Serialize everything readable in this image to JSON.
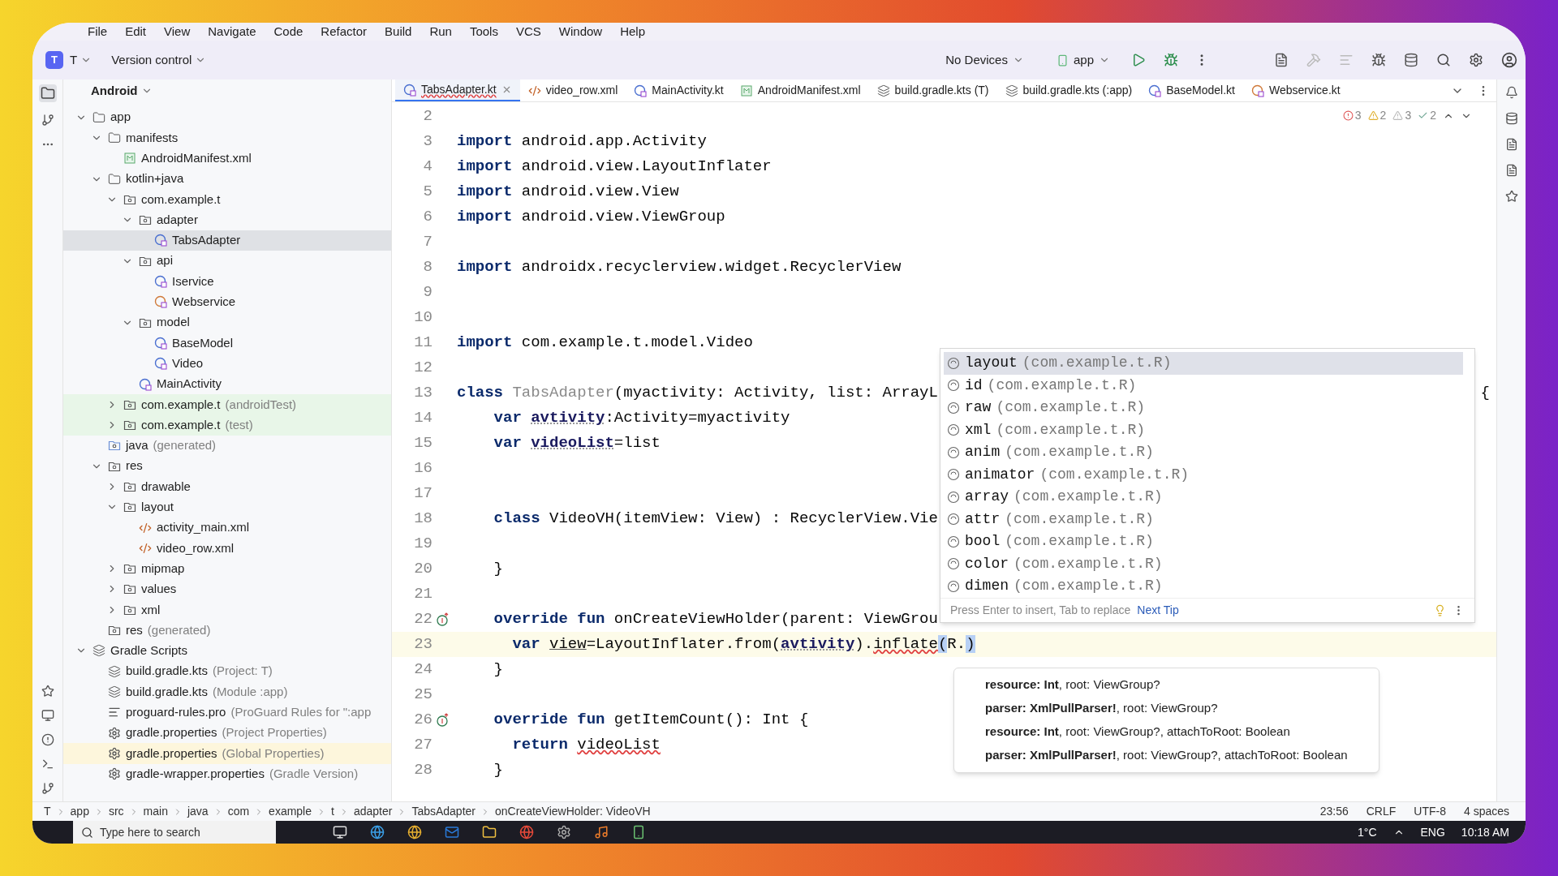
{
  "menu": [
    "File",
    "Edit",
    "View",
    "Navigate",
    "Code",
    "Refactor",
    "Build",
    "Run",
    "Tools",
    "VCS",
    "Window",
    "Help"
  ],
  "toolbar": {
    "project_badge": "T",
    "project": "T",
    "vcs": "Version control",
    "device": "No Devices",
    "config": "app"
  },
  "project_panel": {
    "view": "Android",
    "tree": [
      {
        "label": "app",
        "kind": "module",
        "expanded": true,
        "selected": false,
        "children": [
          {
            "label": "manifests",
            "kind": "folder",
            "expanded": true,
            "selected": false,
            "children": [
              {
                "label": "AndroidManifest.xml",
                "kind": "manifest",
                "selected": false
              }
            ]
          },
          {
            "label": "kotlin+java",
            "kind": "folder",
            "expanded": true,
            "selected": false,
            "children": [
              {
                "label": "com.example.t",
                "kind": "package",
                "expanded": true,
                "selected": false,
                "children": [
                  {
                    "label": "adapter",
                    "kind": "package",
                    "expanded": true,
                    "selected": false,
                    "children": [
                      {
                        "label": "TabsAdapter",
                        "kind": "class",
                        "selected": true
                      }
                    ]
                  },
                  {
                    "label": "api",
                    "kind": "package",
                    "expanded": true,
                    "selected": false,
                    "children": [
                      {
                        "label": "Iservice",
                        "kind": "interface",
                        "selected": false
                      },
                      {
                        "label": "Webservice",
                        "kind": "object",
                        "selected": false
                      }
                    ]
                  },
                  {
                    "label": "model",
                    "kind": "package",
                    "expanded": true,
                    "selected": false,
                    "children": [
                      {
                        "label": "BaseModel",
                        "kind": "class",
                        "selected": false
                      },
                      {
                        "label": "Video",
                        "kind": "class",
                        "selected": false
                      }
                    ]
                  },
                  {
                    "label": "MainActivity",
                    "kind": "class",
                    "selected": false
                  }
                ]
              },
              {
                "label": "com.example.t",
                "note": "(androidTest)",
                "color": "#e8f6e8",
                "kind": "package",
                "expanded": false,
                "selected": false
              },
              {
                "label": "com.example.t",
                "note": "(test)",
                "color": "#e8f6e8",
                "kind": "package",
                "expanded": false,
                "selected": false
              }
            ]
          },
          {
            "label": "java",
            "note": "(generated)",
            "kind": "generated",
            "selected": false
          },
          {
            "label": "res",
            "kind": "resources",
            "expanded": true,
            "selected": false,
            "children": [
              {
                "label": "drawable",
                "kind": "package",
                "expanded": false,
                "selected": false
              },
              {
                "label": "layout",
                "kind": "package",
                "expanded": true,
                "selected": false,
                "children": [
                  {
                    "label": "activity_main.xml",
                    "kind": "xml",
                    "selected": false
                  },
                  {
                    "label": "video_row.xml",
                    "kind": "xml",
                    "selected": false
                  }
                ]
              },
              {
                "label": "mipmap",
                "kind": "package",
                "expanded": false,
                "selected": false
              },
              {
                "label": "values",
                "kind": "package",
                "expanded": false,
                "selected": false
              },
              {
                "label": "xml",
                "kind": "package",
                "expanded": false,
                "selected": false
              }
            ]
          },
          {
            "label": "res",
            "note": "(generated)",
            "kind": "resources",
            "selected": false
          }
        ]
      },
      {
        "label": "Gradle Scripts",
        "kind": "gradle",
        "expanded": true,
        "selected": false,
        "children": [
          {
            "label": "build.gradle.kts",
            "note": "(Project: T)",
            "kind": "gradle",
            "selected": false
          },
          {
            "label": "build.gradle.kts",
            "note": "(Module :app)",
            "kind": "gradle",
            "selected": false
          },
          {
            "label": "proguard-rules.pro",
            "note": "(ProGuard Rules for \":app",
            "kind": "text",
            "selected": false
          },
          {
            "label": "gradle.properties",
            "note": "(Project Properties)",
            "kind": "settings",
            "selected": false
          },
          {
            "label": "gradle.properties",
            "note": "(Global Properties)",
            "color": "#fdf6dc",
            "kind": "settings",
            "selected": false
          },
          {
            "label": "gradle-wrapper.properties",
            "note": "(Gradle Version)",
            "kind": "settings",
            "selected": false
          }
        ]
      }
    ]
  },
  "tabs": [
    {
      "label": "TabsAdapter.kt",
      "kind": "class",
      "selected": true
    },
    {
      "label": "video_row.xml",
      "kind": "xml",
      "selected": false
    },
    {
      "label": "MainActivity.kt",
      "kind": "class",
      "selected": false
    },
    {
      "label": "AndroidManifest.xml",
      "kind": "manifest",
      "selected": false
    },
    {
      "label": "build.gradle.kts (T)",
      "kind": "gradle",
      "selected": false
    },
    {
      "label": "build.gradle.kts (:app)",
      "kind": "gradle",
      "selected": false
    },
    {
      "label": "BaseModel.kt",
      "kind": "class",
      "selected": false
    },
    {
      "label": "Webservice.kt",
      "kind": "object",
      "selected": false
    }
  ],
  "inspections": {
    "errors": "3",
    "warnings": "2",
    "weak_warnings": "3",
    "typos": "2"
  },
  "code": [
    {
      "number": "2",
      "current": false,
      "override_marker": false
    },
    {
      "number": "3",
      "current": false,
      "override_marker": false,
      "segments": [
        {
          "kind": "kw",
          "text": "import "
        },
        {
          "kind": "text",
          "text": "android.app.Activity"
        }
      ]
    },
    {
      "number": "4",
      "current": false,
      "override_marker": false,
      "segments": [
        {
          "kind": "kw",
          "text": "import "
        },
        {
          "kind": "text",
          "text": "android.view.LayoutInflater"
        }
      ]
    },
    {
      "number": "5",
      "current": false,
      "override_marker": false,
      "segments": [
        {
          "kind": "kw",
          "text": "import "
        },
        {
          "kind": "text",
          "text": "android.view.View"
        }
      ]
    },
    {
      "number": "6",
      "current": false,
      "override_marker": false,
      "segments": [
        {
          "kind": "kw",
          "text": "import "
        },
        {
          "kind": "text",
          "text": "android.view.ViewGroup"
        }
      ]
    },
    {
      "number": "7",
      "current": false,
      "override_marker": false
    },
    {
      "number": "8",
      "current": false,
      "override_marker": false,
      "segments": [
        {
          "kind": "kw",
          "text": "import "
        },
        {
          "kind": "text",
          "text": "androidx.recyclerview.widget.RecyclerView"
        }
      ]
    },
    {
      "number": "9",
      "current": false,
      "override_marker": false
    },
    {
      "number": "10",
      "current": false,
      "override_marker": false
    },
    {
      "number": "11",
      "current": false,
      "override_marker": false,
      "segments": [
        {
          "kind": "kw",
          "text": "import "
        },
        {
          "kind": "text",
          "text": "com.example.t.model.Video"
        }
      ]
    },
    {
      "number": "12",
      "current": false,
      "override_marker": false
    },
    {
      "number": "13",
      "current": false,
      "override_marker": false,
      "tail": "{",
      "segments": [
        {
          "kind": "kw",
          "text": "class "
        },
        {
          "kind": "dim",
          "text": "TabsAdapter"
        },
        {
          "kind": "text",
          "text": "(myactivity: Activity, list: ArrayL"
        }
      ]
    },
    {
      "number": "14",
      "current": false,
      "override_marker": false,
      "segments": [
        {
          "kind": "kw",
          "text": "    var "
        },
        {
          "kind": "prop",
          "text": "avtivity"
        },
        {
          "kind": "text",
          "text": ":Activity=myactivity"
        }
      ]
    },
    {
      "number": "15",
      "current": false,
      "override_marker": false,
      "segments": [
        {
          "kind": "kw",
          "text": "    var "
        },
        {
          "kind": "prop",
          "text": "videoList"
        },
        {
          "kind": "text",
          "text": "=list"
        }
      ]
    },
    {
      "number": "16",
      "current": false,
      "override_marker": false
    },
    {
      "number": "17",
      "current": false,
      "override_marker": false
    },
    {
      "number": "18",
      "current": false,
      "override_marker": false,
      "segments": [
        {
          "kind": "kw",
          "text": "    class "
        },
        {
          "kind": "text",
          "text": "VideoVH(itemView: View) : RecyclerView.Vie"
        }
      ]
    },
    {
      "number": "19",
      "current": false,
      "override_marker": false
    },
    {
      "number": "20",
      "current": false,
      "override_marker": false,
      "segments": [
        {
          "kind": "text",
          "text": "    }"
        }
      ]
    },
    {
      "number": "21",
      "current": false,
      "override_marker": false
    },
    {
      "number": "22",
      "current": false,
      "override_marker": true,
      "segments": [
        {
          "kind": "kw",
          "text": "    override fun "
        },
        {
          "kind": "text",
          "text": "onCreateViewHolder(parent: ViewGrou"
        }
      ]
    },
    {
      "number": "23",
      "current": true,
      "override_marker": false,
      "segments": [
        {
          "kind": "kw",
          "text": "      var "
        },
        {
          "kind": "local",
          "text": "view"
        },
        {
          "kind": "text",
          "text": "=LayoutInflater.from("
        },
        {
          "kind": "prop",
          "text": "avtivity"
        },
        {
          "kind": "text",
          "text": ")."
        },
        {
          "kind": "err",
          "text": "inflate"
        },
        {
          "kind": "match",
          "text": "("
        },
        {
          "kind": "text",
          "text": "R."
        },
        {
          "kind": "match",
          "text": ")"
        }
      ]
    },
    {
      "number": "24",
      "current": false,
      "override_marker": false,
      "segments": [
        {
          "kind": "text",
          "text": "    }"
        }
      ]
    },
    {
      "number": "25",
      "current": false,
      "override_marker": false
    },
    {
      "number": "26",
      "current": false,
      "override_marker": true,
      "segments": [
        {
          "kind": "kw",
          "text": "    override fun "
        },
        {
          "kind": "text",
          "text": "getItemCount(): Int {"
        }
      ]
    },
    {
      "number": "27",
      "current": false,
      "override_marker": false,
      "segments": [
        {
          "kind": "kw",
          "text": "      return "
        },
        {
          "kind": "err",
          "text": "videoList"
        }
      ]
    },
    {
      "number": "28",
      "current": false,
      "override_marker": false,
      "segments": [
        {
          "kind": "text",
          "text": "    }"
        }
      ]
    }
  ],
  "completion": {
    "items": [
      {
        "name": "layout",
        "type": "(com.example.t.R)",
        "selected": true
      },
      {
        "name": "id",
        "type": "(com.example.t.R)",
        "selected": false
      },
      {
        "name": "raw",
        "type": "(com.example.t.R)",
        "selected": false
      },
      {
        "name": "xml",
        "type": "(com.example.t.R)",
        "selected": false
      },
      {
        "name": "anim",
        "type": "(com.example.t.R)",
        "selected": false
      },
      {
        "name": "animator",
        "type": "(com.example.t.R)",
        "selected": false
      },
      {
        "name": "array",
        "type": "(com.example.t.R)",
        "selected": false
      },
      {
        "name": "attr",
        "type": "(com.example.t.R)",
        "selected": false
      },
      {
        "name": "bool",
        "type": "(com.example.t.R)",
        "selected": false
      },
      {
        "name": "color",
        "type": "(com.example.t.R)",
        "selected": false
      },
      {
        "name": "dimen",
        "type": "(com.example.t.R)",
        "selected": false
      }
    ],
    "hint": "Press Enter to insert, Tab to replace",
    "tip_link": "Next Tip"
  },
  "parameter_info": [
    "**resource: Int**, root: ViewGroup?",
    "**parser: XmlPullParser!**, root: ViewGroup?",
    "**resource: Int**, root: ViewGroup?, attachToRoot: Boolean",
    "**parser: XmlPullParser!**, root: ViewGroup?, attachToRoot: Boolean"
  ],
  "breadcrumbs": [
    "T",
    "app",
    "src",
    "main",
    "java",
    "com",
    "example",
    "t",
    "adapter",
    "TabsAdapter",
    "onCreateViewHolder: VideoVH"
  ],
  "status": {
    "position": "23:56",
    "line_separator": "CRLF",
    "encoding": "UTF-8",
    "indent": "4 spaces"
  },
  "taskbar": {
    "search_placeholder": "Type here to search",
    "weather": "1°C",
    "language": "ENG",
    "time": "10:18 AM"
  }
}
